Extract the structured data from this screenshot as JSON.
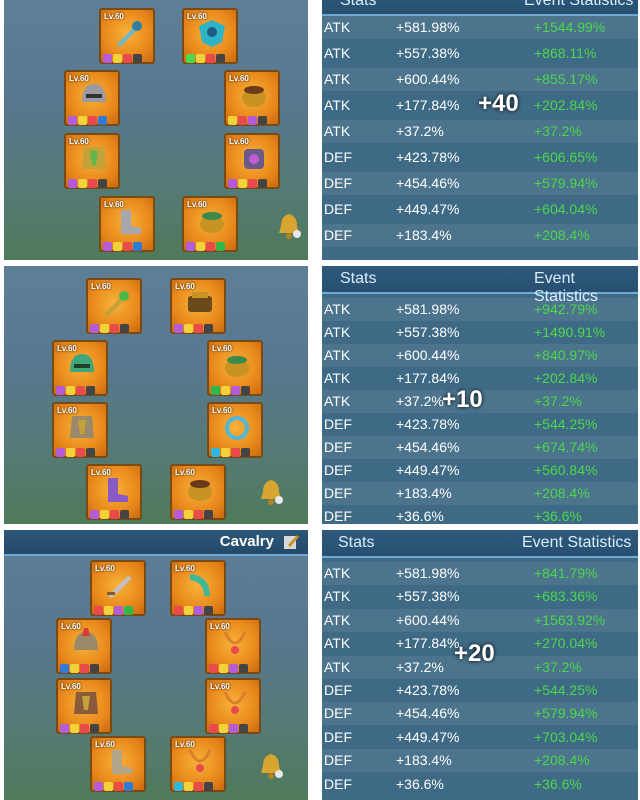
{
  "colors": {
    "accent_blue": "#6fa9d6",
    "event_green": "#4bd84b",
    "slot_orange": "#e9891c"
  },
  "panels": [
    {
      "overlay": "+40",
      "header": {
        "stats": "Stats",
        "event": "Event Statistics"
      },
      "slot_level": "Lv.60",
      "rows": [
        {
          "name": "ATK",
          "base": "+581.98%",
          "event": "+1544.99%"
        },
        {
          "name": "ATK",
          "base": "+557.38%",
          "event": "+868.11%"
        },
        {
          "name": "ATK",
          "base": "+600.44%",
          "event": "+855.17%"
        },
        {
          "name": "ATK",
          "base": "+177.84%",
          "event": "+202.84%"
        },
        {
          "name": "ATK",
          "base": "+37.2%",
          "event": "+37.2%"
        },
        {
          "name": "DEF",
          "base": "+423.78%",
          "event": "+606.65%"
        },
        {
          "name": "DEF",
          "base": "+454.46%",
          "event": "+579.94%"
        },
        {
          "name": "DEF",
          "base": "+449.47%",
          "event": "+604.04%"
        },
        {
          "name": "DEF",
          "base": "+183.4%",
          "event": "+208.4%"
        }
      ]
    },
    {
      "overlay": "+10",
      "header": {
        "stats": "Stats",
        "event": "Event Statistics"
      },
      "slot_level": "Lv.60",
      "rows": [
        {
          "name": "ATK",
          "base": "+581.98%",
          "event": "+942.79%"
        },
        {
          "name": "ATK",
          "base": "+557.38%",
          "event": "+1490.91%"
        },
        {
          "name": "ATK",
          "base": "+600.44%",
          "event": "+840.97%"
        },
        {
          "name": "ATK",
          "base": "+177.84%",
          "event": "+202.84%"
        },
        {
          "name": "ATK",
          "base": "+37.2%",
          "event": "+37.2%"
        },
        {
          "name": "DEF",
          "base": "+423.78%",
          "event": "+544.25%"
        },
        {
          "name": "DEF",
          "base": "+454.46%",
          "event": "+674.74%"
        },
        {
          "name": "DEF",
          "base": "+449.47%",
          "event": "+560.84%"
        },
        {
          "name": "DEF",
          "base": "+183.4%",
          "event": "+208.4%"
        },
        {
          "name": "DEF",
          "base": "+36.6%",
          "event": "+36.6%"
        }
      ]
    },
    {
      "overlay": "+20",
      "title": "Cavalry",
      "header": {
        "stats": "Stats",
        "event": "Event Statistics"
      },
      "slot_level": "Lv.60",
      "rows": [
        {
          "name": "ATK",
          "base": "+581.98%",
          "event": "+841.79%"
        },
        {
          "name": "ATK",
          "base": "+557.38%",
          "event": "+683.36%"
        },
        {
          "name": "ATK",
          "base": "+600.44%",
          "event": "+1563.92%"
        },
        {
          "name": "ATK",
          "base": "+177.84%",
          "event": "+270.04%"
        },
        {
          "name": "ATK",
          "base": "+37.2%",
          "event": "+37.2%"
        },
        {
          "name": "DEF",
          "base": "+423.78%",
          "event": "+544.25%"
        },
        {
          "name": "DEF",
          "base": "+454.46%",
          "event": "+579.94%"
        },
        {
          "name": "DEF",
          "base": "+449.47%",
          "event": "+703.04%"
        },
        {
          "name": "DEF",
          "base": "+183.4%",
          "event": "+208.4%"
        },
        {
          "name": "DEF",
          "base": "+36.6%",
          "event": "+36.6%"
        }
      ]
    }
  ]
}
